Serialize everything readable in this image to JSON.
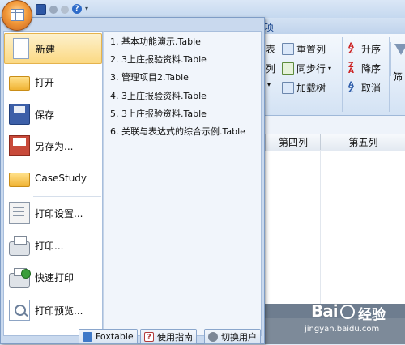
{
  "ribbon": {
    "tab_partial": "项",
    "items": {
      "biao": "表",
      "chongzhi": "重置列",
      "lie": "列",
      "tongbu": "同步行",
      "jiazai": "加载树",
      "shengxu": "升序",
      "jiangxu": "降序",
      "quxiao": "取消",
      "shai": "筛"
    }
  },
  "grid": {
    "columns": [
      "第四列",
      "第五列"
    ]
  },
  "app_menu": {
    "left_items": [
      {
        "label": "新建",
        "icon": "new-document-icon"
      },
      {
        "label": "打开",
        "icon": "open-folder-icon"
      },
      {
        "label": "保存",
        "icon": "save-disk-icon"
      },
      {
        "label": "另存为...",
        "icon": "save-as-icon"
      },
      {
        "label": "CaseStudy",
        "icon": "folder-icon"
      },
      {
        "label": "打印设置...",
        "icon": "print-settings-icon"
      },
      {
        "label": "打印...",
        "icon": "printer-icon"
      },
      {
        "label": "快速打印",
        "icon": "quick-print-icon"
      },
      {
        "label": "打印预览...",
        "icon": "print-preview-icon"
      }
    ],
    "recent_files": [
      "1. 基本功能演示.Table",
      "2. 3上庄报验资料.Table",
      "3. 管理项目2.Table",
      "4. 3上庄报验资料.Table",
      "5. 3上庄报验资料.Table",
      "6. 关联与表达式的综合示例.Table"
    ],
    "bottom_buttons": [
      {
        "label": "Foxtable",
        "icon": "home-icon"
      },
      {
        "label": "使用指南",
        "icon": "help-icon"
      },
      {
        "label": "切换用户",
        "icon": "user-icon"
      }
    ]
  },
  "watermark": {
    "logo": "Bai",
    "text": "经验",
    "url": "jingyan.baidu.com"
  }
}
